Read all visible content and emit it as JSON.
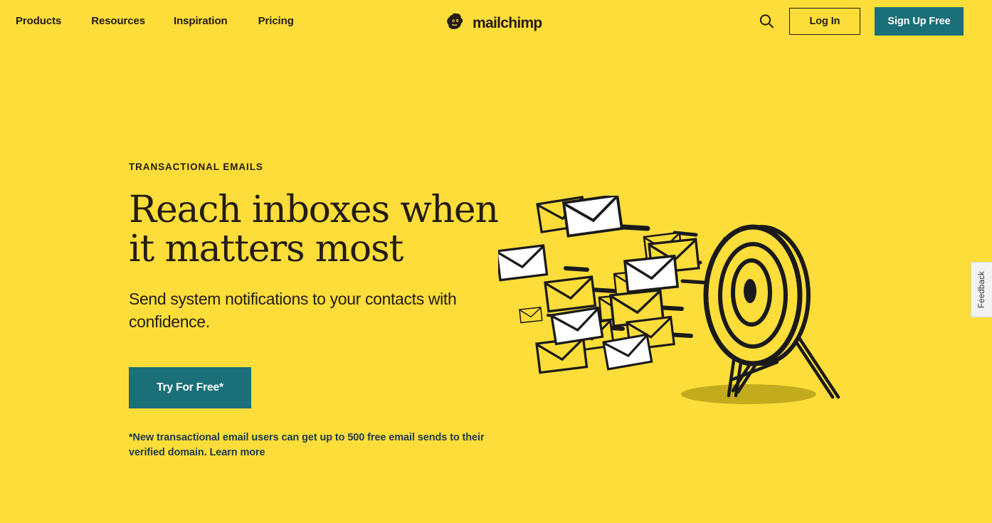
{
  "colors": {
    "background_yellow": "#fddd3a",
    "ink_dark": "#241c15",
    "teal_accent": "#1b6f78",
    "footnote_navy": "#1e3a4a",
    "feedback_gray": "#f2f2f2"
  },
  "header": {
    "nav": [
      {
        "label": "Products"
      },
      {
        "label": "Resources"
      },
      {
        "label": "Inspiration"
      },
      {
        "label": "Pricing"
      }
    ],
    "logo": {
      "icon": "mailchimp-freddie-icon",
      "text": "mailchimp"
    },
    "search_icon": "search-icon",
    "login_label": "Log In",
    "signup_label": "Sign Up Free"
  },
  "hero": {
    "eyebrow": "TRANSACTIONAL EMAILS",
    "title": "Reach inboxes when it matters most",
    "subtitle": "Send system notifications to your contacts with confidence.",
    "cta_label": "Try For Free*",
    "footnote": "*New transactional email users can get up to 500 free email sends to their verified domain. ",
    "footnote_link": "Learn more",
    "illustration_alt": "envelopes-flying-to-target-illustration"
  },
  "feedback": {
    "label": "Feedback"
  }
}
